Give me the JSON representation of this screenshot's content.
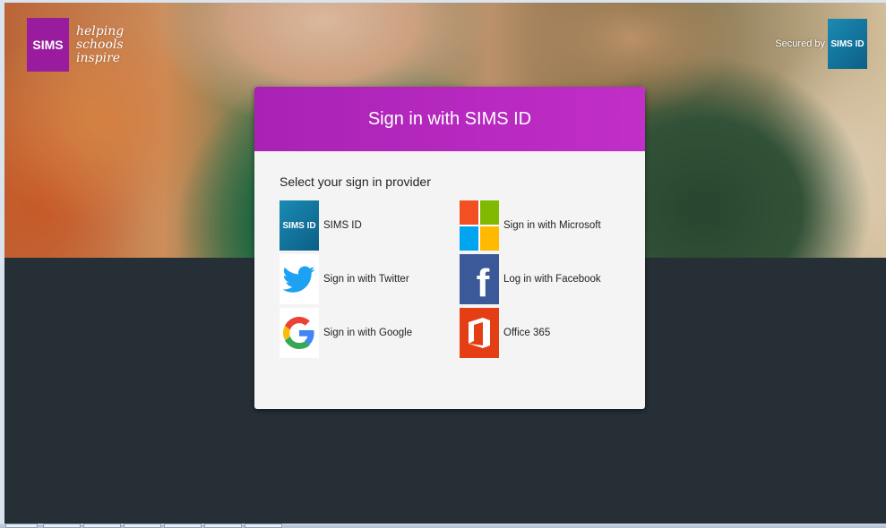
{
  "brand": {
    "logo_text": "SIMS",
    "tagline": "helping\nschools\ninspire"
  },
  "secured": {
    "label": "Secured by",
    "badge_text": "SIMS ID"
  },
  "dialog": {
    "title": "Sign in with SIMS ID",
    "subtitle": "Select your sign in provider",
    "providers": [
      {
        "label": "SIMS ID",
        "icon": "sims-id-icon",
        "icon_text": "SIMS ID"
      },
      {
        "label": "Sign in with Microsoft",
        "icon": "microsoft-icon"
      },
      {
        "label": "Sign in with Twitter",
        "icon": "twitter-icon"
      },
      {
        "label": "Log in with Facebook",
        "icon": "facebook-icon",
        "icon_text": "f"
      },
      {
        "label": "Sign in with Google",
        "icon": "google-icon"
      },
      {
        "label": "Office 365",
        "icon": "office-365-icon"
      }
    ]
  },
  "colors": {
    "header": "#b126bd",
    "brand": "#9a1c9e",
    "sims_badge": "#1a8bb3",
    "facebook": "#3b5998",
    "office": "#e43e14",
    "page_background": "#262e36"
  }
}
